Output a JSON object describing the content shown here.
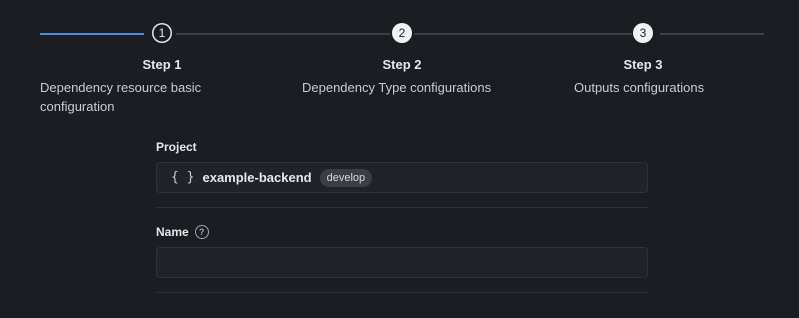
{
  "stepper": {
    "steps": [
      {
        "number": "1",
        "title": "Step 1",
        "description": "Dependency resource basic configuration"
      },
      {
        "number": "2",
        "title": "Step 2",
        "description": "Dependency Type configurations"
      },
      {
        "number": "3",
        "title": "Step 3",
        "description": "Outputs configurations"
      }
    ],
    "current_step": 1,
    "colors": {
      "progress": "#4a8fd6",
      "track": "#3a3f4a"
    }
  },
  "form": {
    "project": {
      "label": "Project",
      "icon": "braces-icon",
      "icon_glyph": "{ }",
      "value": "example-backend",
      "badge": "develop"
    },
    "name": {
      "label": "Name",
      "help_icon": "help-circle-icon",
      "help_glyph": "?",
      "value": "",
      "placeholder": ""
    }
  }
}
